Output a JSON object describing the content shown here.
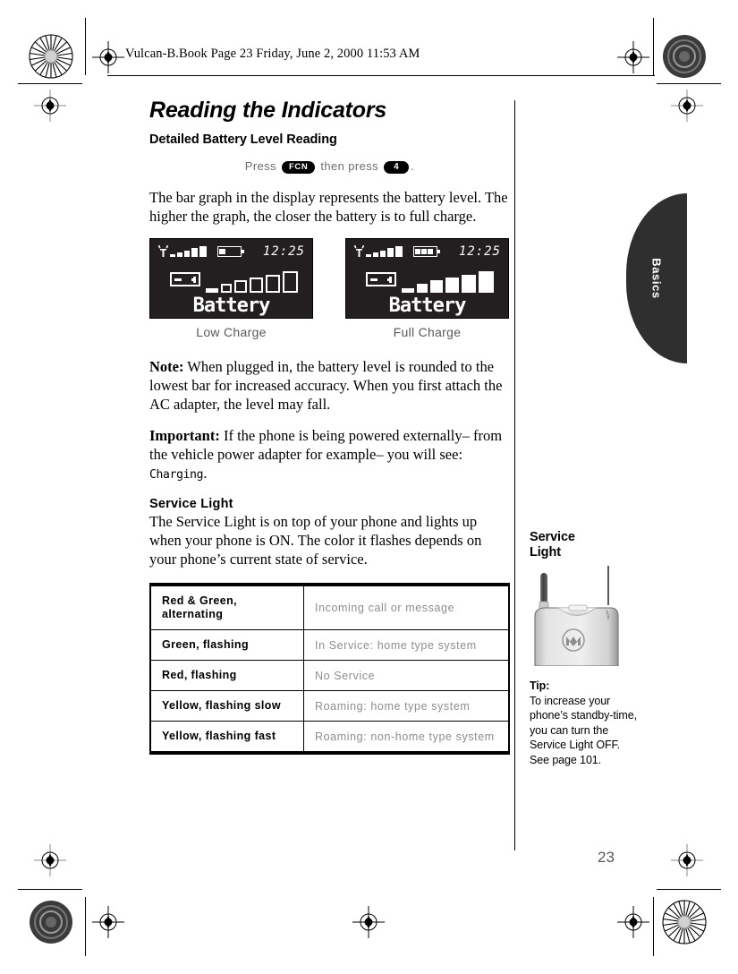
{
  "running_head": "Vulcan-B.Book  Page 23  Friday, June 2, 2000  11:53 AM",
  "page_number": "23",
  "tab": {
    "label": "Basics"
  },
  "main": {
    "title": "Reading the Indicators",
    "subtitle": "Detailed Battery Level Reading",
    "press_line": {
      "press_word": "Press",
      "key1": "FCN",
      "then_word": "then press",
      "key2": "4",
      "period": "."
    },
    "intro": "The bar graph in the display represents the battery level. The higher the graph, the closer the battery is to full charge.",
    "screens": [
      {
        "caption": "Low Charge",
        "clock": "12:25",
        "label": "Battery",
        "signal_bars": 5,
        "battery_icon_segments": 1,
        "graph_filled": 2,
        "graph_total": 7
      },
      {
        "caption": "Full Charge",
        "clock": "12:25",
        "label": "Battery",
        "signal_bars": 5,
        "battery_icon_segments": 3,
        "graph_filled": 6,
        "graph_total": 7
      }
    ],
    "note": {
      "lead": "Note:",
      "text": " When plugged in, the battery level is rounded to the lowest bar for increased accuracy. When you first attach the AC adapter, the level may fall."
    },
    "important": {
      "lead": "Important:",
      "text": " If the phone is being powered externally– from the vehicle power adapter for example– you will see: ",
      "mono": "Charging",
      "period": "."
    },
    "service_light": {
      "heading": "Service Light",
      "text": "The Service Light is on top of your phone and lights up when your phone is ON. The color it flashes depends on your phone’s current state of service."
    },
    "table": {
      "rows": [
        {
          "state": "Red & Green, alternating",
          "meaning": "Incoming call or message"
        },
        {
          "state": "Green, flashing",
          "meaning": "In Service: home type system"
        },
        {
          "state": "Red, flashing",
          "meaning": "No Service"
        },
        {
          "state": "Yellow, flashing slow",
          "meaning": "Roaming: home type system"
        },
        {
          "state": "Yellow, flashing fast",
          "meaning": "Roaming: non-home type system"
        }
      ]
    }
  },
  "sidebar": {
    "callout_title": "Service\nLight",
    "callout_line1": "Service",
    "callout_line2": "Light",
    "tip_lead": "Tip:",
    "tip_text": "To increase your phone’s standby-time, you can turn the Service Light OFF. See page 101."
  },
  "colors": {
    "lcd_background": "#231f20",
    "lcd_foreground": "#ffffff",
    "tab_background": "#2f2f2f",
    "table_value_text": "#8d8d8f",
    "caption_text": "#59595b"
  }
}
